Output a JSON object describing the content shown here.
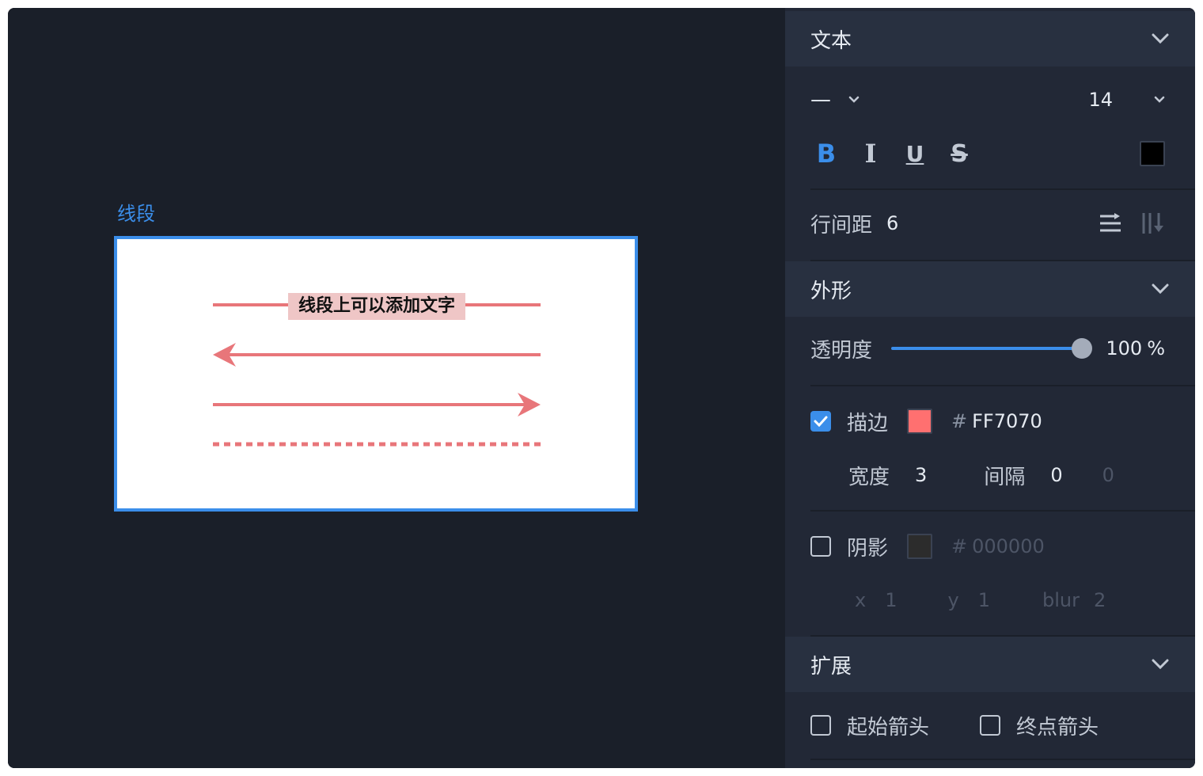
{
  "canvas": {
    "shape_label": "线段",
    "line_text": "线段上可以添加文字",
    "line_color": "#E8767A"
  },
  "text_section": {
    "title": "文本",
    "font_family": "—",
    "font_size": "14",
    "bold": "B",
    "italic": "I",
    "underline": "U",
    "strike": "S",
    "color": "#000000",
    "line_spacing_label": "行间距",
    "line_spacing_value": "6"
  },
  "appearance": {
    "title": "外形",
    "opacity_label": "透明度",
    "opacity_value": "100",
    "opacity_unit": "%",
    "opacity": 1.0,
    "stroke": {
      "checked": true,
      "label": "描边",
      "color": "#FF7070",
      "hash": "#",
      "hex": "FF7070",
      "width_label": "宽度",
      "width_value": "3",
      "gap_label": "间隔",
      "gap_value": "0",
      "gap_value2": "0"
    },
    "shadow": {
      "checked": false,
      "label": "阴影",
      "color": "#000000",
      "hash": "#",
      "hex": "000000",
      "x_label": "x",
      "x_value": "1",
      "y_label": "y",
      "y_value": "1",
      "blur_label": "blur",
      "blur_value": "2"
    }
  },
  "extension": {
    "title": "扩展",
    "start_arrow_label": "起始箭头",
    "end_arrow_label": "终点箭头",
    "start_arrow_checked": false,
    "end_arrow_checked": false
  },
  "colors": {
    "accent": "#3B8EEA",
    "panel_bg": "#222836",
    "header_bg": "#283040",
    "canvas_bg": "#1A1F29"
  }
}
